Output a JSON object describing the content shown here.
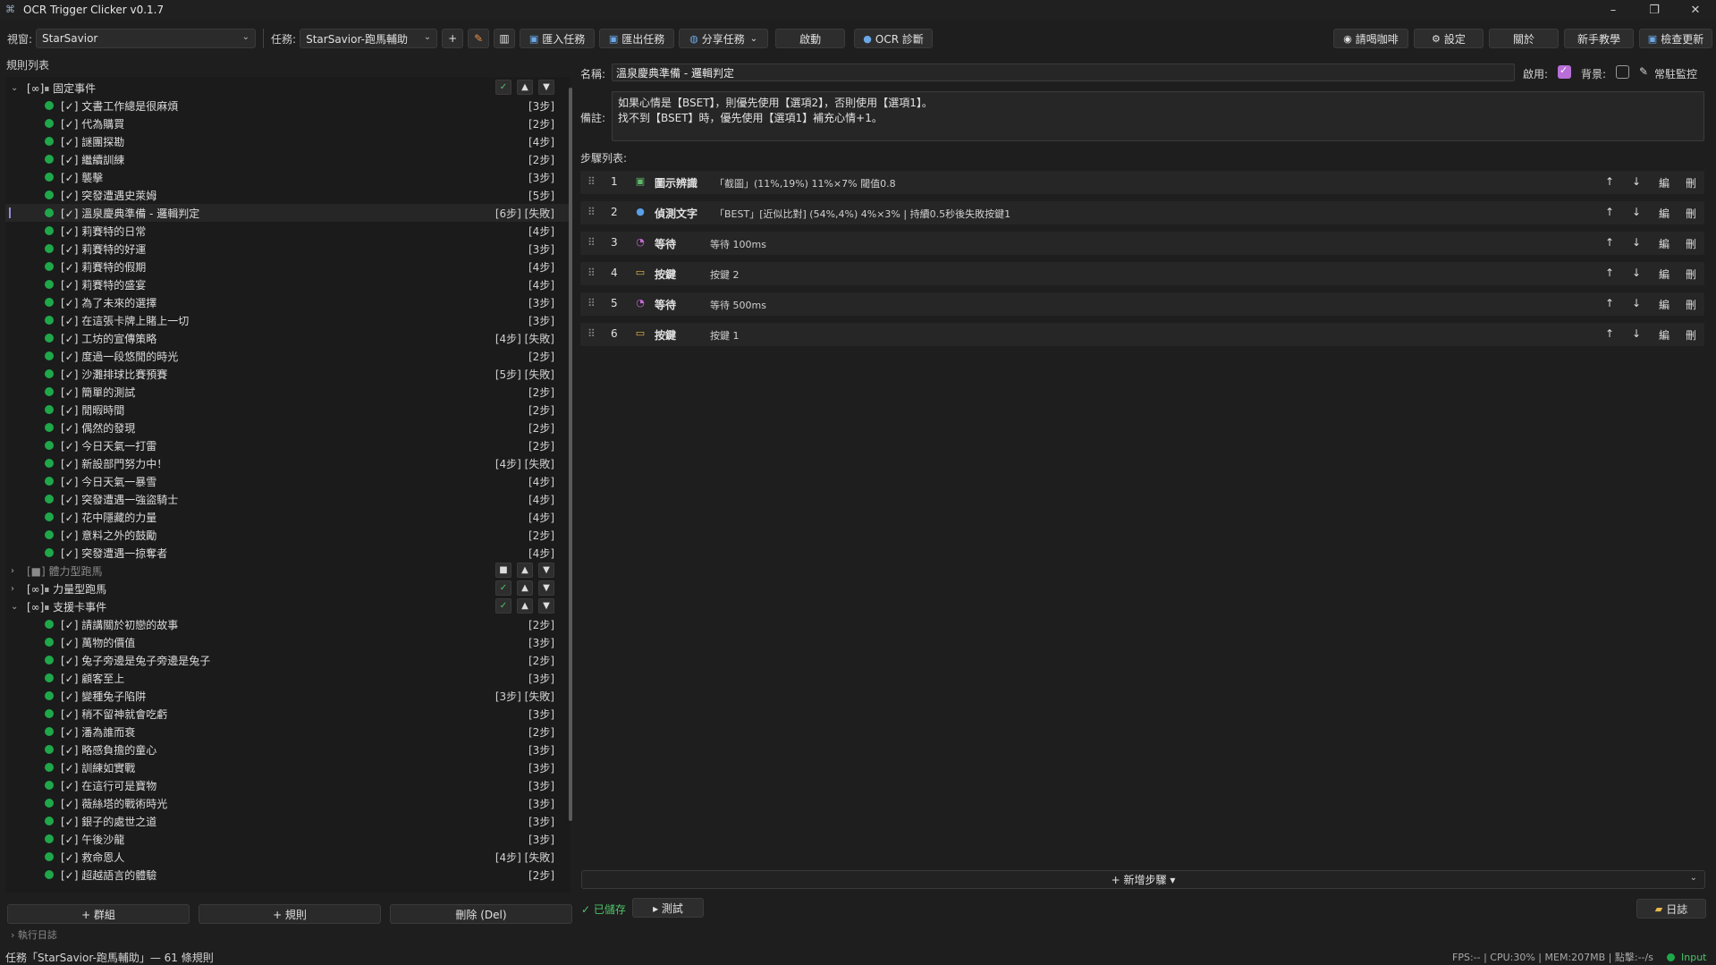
{
  "window": {
    "title": "OCR Trigger Clicker v0.1.7",
    "min": "–",
    "max": "❐",
    "close": "✕"
  },
  "toolbar": {
    "window_label": "視窗:",
    "window_value": "StarSavior",
    "task_label": "任務:",
    "task_value": "StarSavior-跑馬輔助",
    "add": "+",
    "import_task": "匯入任務",
    "export_task": "匯出任務",
    "share_task": "分享任務",
    "start": "啟動",
    "ocr_diag": "OCR 診斷",
    "coffee": "請喝咖啡",
    "settings": "設定",
    "about": "關於",
    "tutorial": "新手教學",
    "check_update": "檢查更新"
  },
  "left": {
    "title": "規則列表",
    "groups": [
      {
        "name": "[∞]⏸ 固定事件",
        "expanded": true,
        "enabled": true,
        "rules": [
          {
            "name": "[✓] 文書工作總是很麻煩",
            "steps": "[3步]"
          },
          {
            "name": "[✓] 代為購買",
            "steps": "[2步]"
          },
          {
            "name": "[✓] 謎團探勘",
            "steps": "[4步]"
          },
          {
            "name": "[✓] 繼續訓練",
            "steps": "[2步]"
          },
          {
            "name": "[✓] 襲擊",
            "steps": "[3步]"
          },
          {
            "name": "[✓] 突發遭遇史萊姆",
            "steps": "[5步]"
          },
          {
            "name": "[✓] 溫泉慶典準備 - 邏輯判定",
            "steps": "[6步] [失敗]",
            "selected": true
          },
          {
            "name": "[✓] 莉賽特的日常",
            "steps": "[4步]"
          },
          {
            "name": "[✓] 莉賽特的好運",
            "steps": "[3步]"
          },
          {
            "name": "[✓] 莉賽特的假期",
            "steps": "[4步]"
          },
          {
            "name": "[✓] 莉賽特的盛宴",
            "steps": "[4步]"
          },
          {
            "name": "[✓] 為了未來的選擇",
            "steps": "[3步]"
          },
          {
            "name": "[✓] 在這張卡牌上賭上一切",
            "steps": "[3步]"
          },
          {
            "name": "[✓] 工坊的宣傳策略",
            "steps": "[4步] [失敗]"
          },
          {
            "name": "[✓] 度過一段悠閒的時光",
            "steps": "[2步]"
          },
          {
            "name": "[✓] 沙灘排球比賽預賽",
            "steps": "[5步] [失敗]"
          },
          {
            "name": "[✓] 簡單的測試",
            "steps": "[2步]"
          },
          {
            "name": "[✓] 閒暇時間",
            "steps": "[2步]"
          },
          {
            "name": "[✓] 偶然的發現",
            "steps": "[2步]"
          },
          {
            "name": "[✓] 今日天氣一打雷",
            "steps": "[2步]"
          },
          {
            "name": "[✓] 新設部門努力中！",
            "steps": "[4步] [失敗]"
          },
          {
            "name": "[✓] 今日天氣一暴雪",
            "steps": "[4步]"
          },
          {
            "name": "[✓] 突發遭遇一強盜騎士",
            "steps": "[4步]"
          },
          {
            "name": "[✓] 花中隱藏的力量",
            "steps": "[4步]"
          },
          {
            "name": "[✓] 意料之外的鼓勵",
            "steps": "[2步]"
          },
          {
            "name": "[✓] 突發遭遇一掠奪者",
            "steps": "[4步]"
          }
        ]
      },
      {
        "name": "[■] 體力型跑馬",
        "expanded": false,
        "enabled": false,
        "rules": []
      },
      {
        "name": "[∞]⏸ 力量型跑馬",
        "expanded": false,
        "enabled": true,
        "rules": []
      },
      {
        "name": "[∞]⏸ 支援卡事件",
        "expanded": true,
        "enabled": true,
        "rules": [
          {
            "name": "[✓] 請講關於初戀的故事",
            "steps": "[2步]"
          },
          {
            "name": "[✓] 萬物的價值",
            "steps": "[3步]"
          },
          {
            "name": "[✓] 兔子旁邊是兔子旁邊是兔子",
            "steps": "[2步]"
          },
          {
            "name": "[✓] 顧客至上",
            "steps": "[3步]"
          },
          {
            "name": "[✓] 變種兔子陷阱",
            "steps": "[3步] [失敗]"
          },
          {
            "name": "[✓] 稍不留神就會吃虧",
            "steps": "[3步]"
          },
          {
            "name": "[✓] 潘為誰而衰",
            "steps": "[2步]"
          },
          {
            "name": "[✓] 略感負擔的童心",
            "steps": "[3步]"
          },
          {
            "name": "[✓] 訓練如實戰",
            "steps": "[3步]"
          },
          {
            "name": "[✓] 在這行可是寶物",
            "steps": "[3步]"
          },
          {
            "name": "[✓] 薇絲塔的戰術時光",
            "steps": "[3步]"
          },
          {
            "name": "[✓] 銀子的處世之道",
            "steps": "[3步]"
          },
          {
            "name": "[✓] 午後沙龍",
            "steps": "[3步]"
          },
          {
            "name": "[✓] 救命恩人",
            "steps": "[4步] [失敗]"
          },
          {
            "name": "[✓] 超越語言的體驗",
            "steps": "[2步]"
          }
        ]
      }
    ],
    "add_group": "+ 群組",
    "add_rule": "+ 規則",
    "delete": "刪除 (Del)",
    "exec_log": "› 執行日誌"
  },
  "right": {
    "name_label": "名稱:",
    "name_value": "溫泉慶典準備 - 邏輯判定",
    "enable_label": "啟用:",
    "enabled": true,
    "background_label": "背景:",
    "background": false,
    "monitor_label": "常駐監控",
    "note_label": "備註:",
    "note_line1": "如果心情是【BSET】，則優先使用【選項2】，否則使用【選項1】。",
    "note_line2": "找不到【BSET】時，優先使用【選項1】補充心情+1。",
    "steps_title": "步驟列表:",
    "steps": [
      {
        "num": "1",
        "icon": "image-icon",
        "type": "圖示辨識",
        "desc": "「截圖」(11%,19%) 11%×7% 閾值0.8"
      },
      {
        "num": "2",
        "icon": "search-icon",
        "type": "偵測文字",
        "desc": "「BEST」[近似比對] (54%,4%) 4%×3% | 持續0.5秒後失敗按鍵1"
      },
      {
        "num": "3",
        "icon": "timer-icon",
        "type": "等待",
        "desc": "等待 100ms"
      },
      {
        "num": "4",
        "icon": "keyboard-icon",
        "type": "按鍵",
        "desc": "按鍵 2"
      },
      {
        "num": "5",
        "icon": "timer-icon",
        "type": "等待",
        "desc": "等待 500ms"
      },
      {
        "num": "6",
        "icon": "keyboard-icon",
        "type": "按鍵",
        "desc": "按鍵 1"
      }
    ],
    "step_actions": {
      "up": "↑",
      "down": "↓",
      "edit": "編",
      "delete": "刪"
    },
    "add_step": "+ 新增步驟 ▾",
    "saved": "已儲存",
    "test": "▸ 測試",
    "log": "日誌"
  },
  "status": {
    "left": "任務「StarSavior-跑馬輔助」— 61 條規則",
    "right": "FPS:-- | CPU:30% | MEM:207MB | 點擊:--/s",
    "input": "Input"
  },
  "colors": {
    "accent": "#b86fd8",
    "dot_green": "#1fa84a",
    "check_green": "#4fc36a"
  }
}
